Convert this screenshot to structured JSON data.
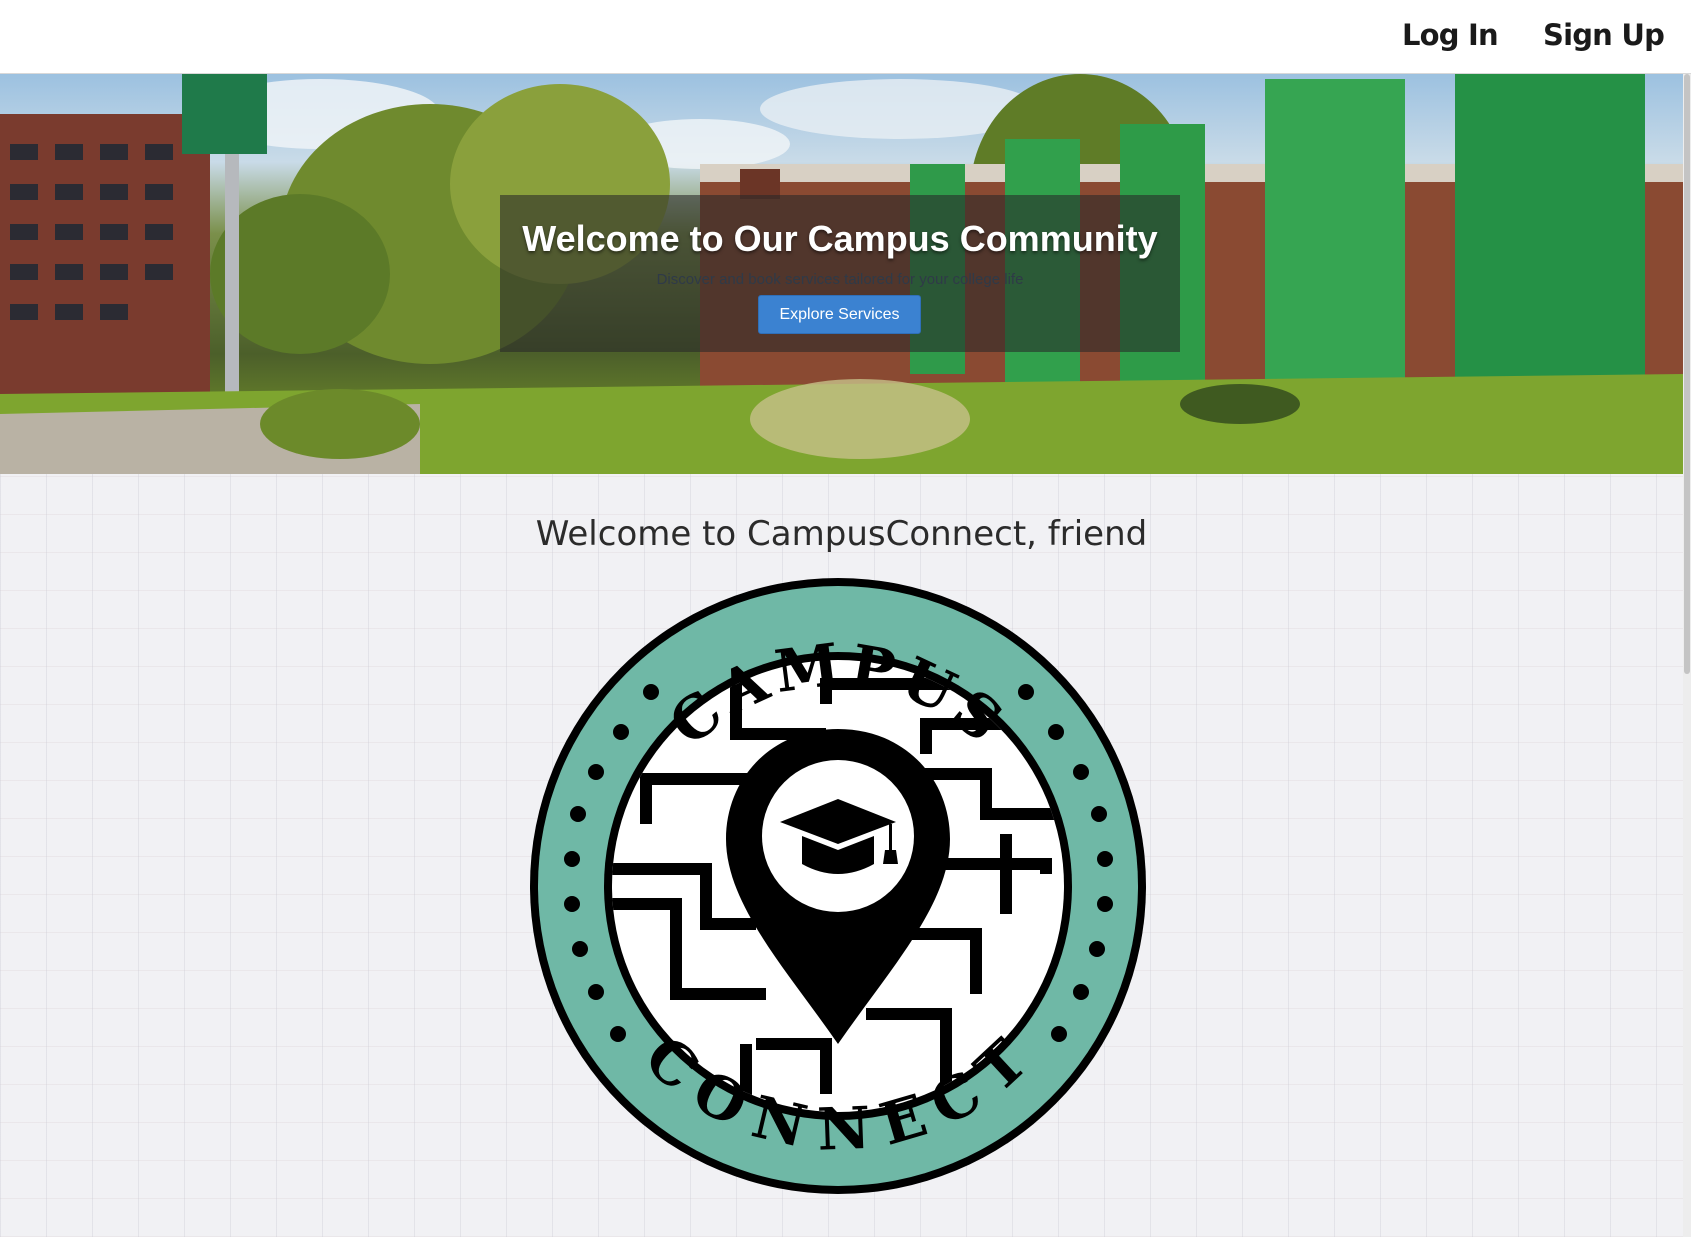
{
  "nav": {
    "login_label": "Log In",
    "signup_label": "Sign Up"
  },
  "hero": {
    "title": "Welcome to Our Campus Community",
    "subtitle": "Discover and book services tailored for your college life",
    "button_label": "Explore Services"
  },
  "main": {
    "welcome_text": "Welcome to CampusConnect, friend",
    "logo": {
      "top_text": "CAMPUS",
      "bottom_text": "CONNECT",
      "ring_color": "#6fb8a6",
      "icon": "map-pin-graduation-cap-icon"
    }
  },
  "colors": {
    "button": "#3b82d1",
    "logo_ring": "#6fb8a6"
  }
}
